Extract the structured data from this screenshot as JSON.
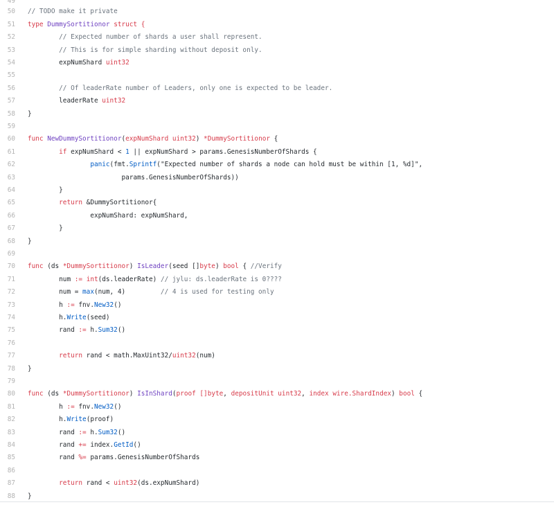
{
  "editor": {
    "first_visible_line_number": "49",
    "first_visible_code": "",
    "line_numbers": [
      "50",
      "51",
      "52",
      "53",
      "54",
      "55",
      "56",
      "57",
      "58",
      "59",
      "60",
      "61",
      "62",
      "63",
      "64",
      "65",
      "66",
      "67",
      "68",
      "69",
      "70",
      "71",
      "72",
      "73",
      "74",
      "75",
      "76",
      "77",
      "78",
      "79",
      "80",
      "81",
      "82",
      "83",
      "84",
      "85",
      "86",
      "87",
      "88"
    ],
    "lines": [
      {
        "tokens": [
          {
            "text": "// TODO make it private",
            "kind": "comment"
          }
        ]
      },
      {
        "tokens": [
          {
            "text": "type ",
            "kind": "keyword"
          },
          {
            "text": "DummySortitionor",
            "kind": "name"
          },
          {
            "text": " struct {",
            "kind": "keyword"
          }
        ]
      },
      {
        "tokens": [
          {
            "text": "        // Expected number of shards a user shall represent.",
            "kind": "comment"
          }
        ]
      },
      {
        "tokens": [
          {
            "text": "        // This is for simple sharding without deposit only.",
            "kind": "comment"
          }
        ]
      },
      {
        "tokens": [
          {
            "text": "        expNumShard ",
            "kind": "plain"
          },
          {
            "text": "uint32",
            "kind": "type"
          }
        ]
      },
      {
        "tokens": []
      },
      {
        "tokens": [
          {
            "text": "        // Of leaderRate number of Leaders, only one is expected to be leader.",
            "kind": "comment"
          }
        ]
      },
      {
        "tokens": [
          {
            "text": "        leaderRate ",
            "kind": "plain"
          },
          {
            "text": "uint32",
            "kind": "type"
          }
        ]
      },
      {
        "tokens": [
          {
            "text": "}",
            "kind": "plain"
          }
        ]
      },
      {
        "tokens": []
      },
      {
        "tokens": [
          {
            "text": "func ",
            "kind": "keyword"
          },
          {
            "text": "NewDummySortitionor",
            "kind": "func"
          },
          {
            "text": "(",
            "kind": "plain"
          },
          {
            "text": "expNumShard uint32",
            "kind": "keyword"
          },
          {
            "text": ") ",
            "kind": "plain"
          },
          {
            "text": "*DummySortitionor",
            "kind": "keyword"
          },
          {
            "text": " {",
            "kind": "plain"
          }
        ]
      },
      {
        "tokens": [
          {
            "text": "        ",
            "kind": "plain"
          },
          {
            "text": "if",
            "kind": "keyword"
          },
          {
            "text": " expNumShard < ",
            "kind": "plain"
          },
          {
            "text": "1",
            "kind": "builtin"
          },
          {
            "text": " || expNumShard > params.GenesisNumberOfShards {",
            "kind": "plain"
          }
        ]
      },
      {
        "tokens": [
          {
            "text": "                ",
            "kind": "plain"
          },
          {
            "text": "panic",
            "kind": "builtin"
          },
          {
            "text": "(fmt.",
            "kind": "plain"
          },
          {
            "text": "Sprintf",
            "kind": "builtin"
          },
          {
            "text": "(\"Expected number of shards a node can hold must be within [1, %d]\",",
            "kind": "plain"
          }
        ]
      },
      {
        "tokens": [
          {
            "text": "                        params.GenesisNumberOfShards))",
            "kind": "plain"
          }
        ]
      },
      {
        "tokens": [
          {
            "text": "        }",
            "kind": "plain"
          }
        ]
      },
      {
        "tokens": [
          {
            "text": "        ",
            "kind": "plain"
          },
          {
            "text": "return",
            "kind": "keyword"
          },
          {
            "text": " &DummySortitionor{",
            "kind": "plain"
          }
        ]
      },
      {
        "tokens": [
          {
            "text": "                expNumShard: expNumShard,",
            "kind": "plain"
          }
        ]
      },
      {
        "tokens": [
          {
            "text": "        }",
            "kind": "plain"
          }
        ]
      },
      {
        "tokens": [
          {
            "text": "}",
            "kind": "plain"
          }
        ]
      },
      {
        "tokens": []
      },
      {
        "tokens": [
          {
            "text": "func ",
            "kind": "keyword"
          },
          {
            "text": "(ds ",
            "kind": "plain"
          },
          {
            "text": "*DummySortitionor",
            "kind": "keyword"
          },
          {
            "text": ") ",
            "kind": "plain"
          },
          {
            "text": "IsLeader",
            "kind": "func"
          },
          {
            "text": "(seed []",
            "kind": "plain"
          },
          {
            "text": "byte",
            "kind": "type"
          },
          {
            "text": ") ",
            "kind": "plain"
          },
          {
            "text": "bool",
            "kind": "type"
          },
          {
            "text": " { ",
            "kind": "plain"
          },
          {
            "text": "//Verify",
            "kind": "comment"
          }
        ]
      },
      {
        "tokens": [
          {
            "text": "        num ",
            "kind": "plain"
          },
          {
            "text": ":=",
            "kind": "keyword"
          },
          {
            "text": " ",
            "kind": "plain"
          },
          {
            "text": "int",
            "kind": "type"
          },
          {
            "text": "(ds.leaderRate) ",
            "kind": "plain"
          },
          {
            "text": "// jylu: ds.leaderRate is 0????",
            "kind": "comment"
          }
        ]
      },
      {
        "tokens": [
          {
            "text": "        num = ",
            "kind": "plain"
          },
          {
            "text": "max",
            "kind": "builtin"
          },
          {
            "text": "(num, 4)         ",
            "kind": "plain"
          },
          {
            "text": "// 4 is used for testing only",
            "kind": "comment"
          }
        ]
      },
      {
        "tokens": [
          {
            "text": "        h ",
            "kind": "plain"
          },
          {
            "text": ":=",
            "kind": "keyword"
          },
          {
            "text": " fnv.",
            "kind": "plain"
          },
          {
            "text": "New32",
            "kind": "builtin"
          },
          {
            "text": "()",
            "kind": "plain"
          }
        ]
      },
      {
        "tokens": [
          {
            "text": "        h.",
            "kind": "plain"
          },
          {
            "text": "Write",
            "kind": "builtin"
          },
          {
            "text": "(seed)",
            "kind": "plain"
          }
        ]
      },
      {
        "tokens": [
          {
            "text": "        rand ",
            "kind": "plain"
          },
          {
            "text": ":=",
            "kind": "keyword"
          },
          {
            "text": " h.",
            "kind": "plain"
          },
          {
            "text": "Sum32",
            "kind": "builtin"
          },
          {
            "text": "()",
            "kind": "plain"
          }
        ]
      },
      {
        "tokens": []
      },
      {
        "tokens": [
          {
            "text": "        ",
            "kind": "plain"
          },
          {
            "text": "return",
            "kind": "keyword"
          },
          {
            "text": " rand < math.MaxUint32/",
            "kind": "plain"
          },
          {
            "text": "uint32",
            "kind": "type"
          },
          {
            "text": "(num)",
            "kind": "plain"
          }
        ]
      },
      {
        "tokens": [
          {
            "text": "}",
            "kind": "plain"
          }
        ]
      },
      {
        "tokens": []
      },
      {
        "tokens": [
          {
            "text": "func ",
            "kind": "keyword"
          },
          {
            "text": "(ds ",
            "kind": "plain"
          },
          {
            "text": "*DummySortitionor",
            "kind": "keyword"
          },
          {
            "text": ") ",
            "kind": "plain"
          },
          {
            "text": "IsInShard",
            "kind": "func"
          },
          {
            "text": "(",
            "kind": "plain"
          },
          {
            "text": "proof []",
            "kind": "keyword"
          },
          {
            "text": "byte",
            "kind": "type"
          },
          {
            "text": ", ",
            "kind": "plain"
          },
          {
            "text": "depositUnit uint32",
            "kind": "keyword"
          },
          {
            "text": ", ",
            "kind": "plain"
          },
          {
            "text": "index wire.ShardIndex",
            "kind": "keyword"
          },
          {
            "text": ") ",
            "kind": "plain"
          },
          {
            "text": "bool",
            "kind": "type"
          },
          {
            "text": " {",
            "kind": "plain"
          }
        ]
      },
      {
        "tokens": [
          {
            "text": "        h ",
            "kind": "plain"
          },
          {
            "text": ":=",
            "kind": "keyword"
          },
          {
            "text": " fnv.",
            "kind": "plain"
          },
          {
            "text": "New32",
            "kind": "builtin"
          },
          {
            "text": "()",
            "kind": "plain"
          }
        ]
      },
      {
        "tokens": [
          {
            "text": "        h.",
            "kind": "plain"
          },
          {
            "text": "Write",
            "kind": "builtin"
          },
          {
            "text": "(proof)",
            "kind": "plain"
          }
        ]
      },
      {
        "tokens": [
          {
            "text": "        rand ",
            "kind": "plain"
          },
          {
            "text": ":=",
            "kind": "keyword"
          },
          {
            "text": " h.",
            "kind": "plain"
          },
          {
            "text": "Sum32",
            "kind": "builtin"
          },
          {
            "text": "()",
            "kind": "plain"
          }
        ]
      },
      {
        "tokens": [
          {
            "text": "        rand ",
            "kind": "plain"
          },
          {
            "text": "+=",
            "kind": "keyword"
          },
          {
            "text": " index.",
            "kind": "plain"
          },
          {
            "text": "GetId",
            "kind": "builtin"
          },
          {
            "text": "()",
            "kind": "plain"
          }
        ]
      },
      {
        "tokens": [
          {
            "text": "        rand ",
            "kind": "plain"
          },
          {
            "text": "%=",
            "kind": "keyword"
          },
          {
            "text": " params.GenesisNumberOfShards",
            "kind": "plain"
          }
        ]
      },
      {
        "tokens": []
      },
      {
        "tokens": [
          {
            "text": "        ",
            "kind": "plain"
          },
          {
            "text": "return",
            "kind": "keyword"
          },
          {
            "text": " rand < ",
            "kind": "plain"
          },
          {
            "text": "uint32",
            "kind": "type"
          },
          {
            "text": "(ds.expNumShard)",
            "kind": "plain"
          }
        ]
      },
      {
        "tokens": [
          {
            "text": "}",
            "kind": "plain"
          }
        ]
      }
    ]
  },
  "colors": {
    "background": "#ffffff",
    "line_number": "#b3b3b3",
    "keyword": "#d73a49",
    "function_name": "#6f42c1",
    "builtin": "#005cc5",
    "comment": "#6a737d",
    "plain": "#24292e"
  }
}
